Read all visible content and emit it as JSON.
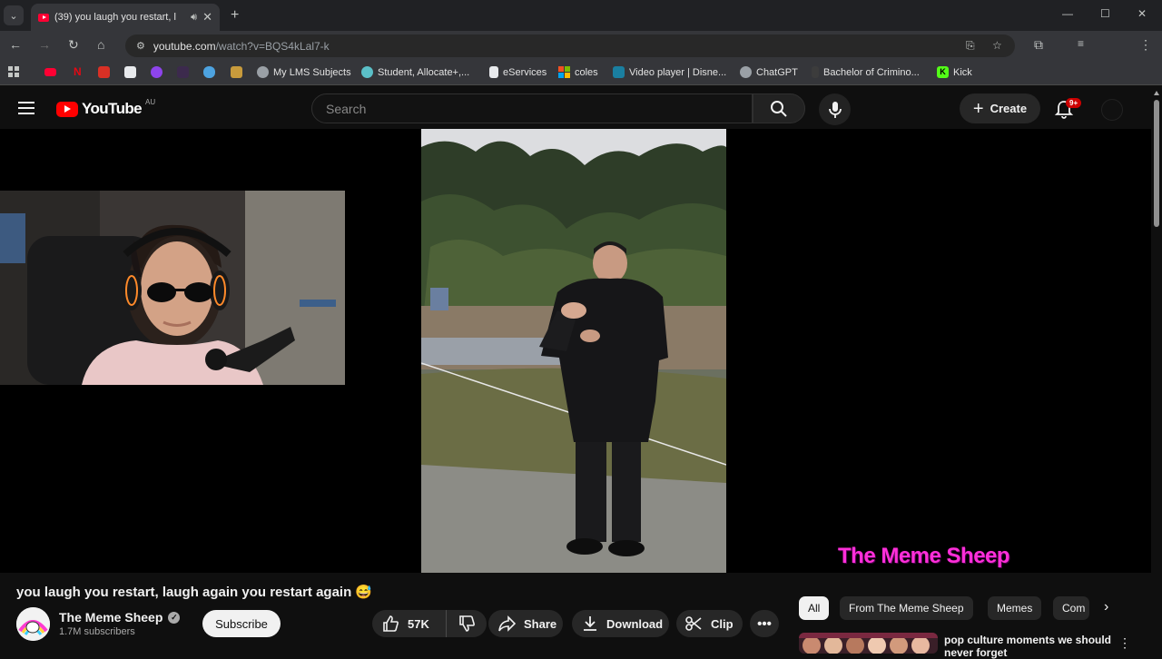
{
  "browser": {
    "tab_title": "(39) you laugh you restart, l",
    "url_host": "youtube.com",
    "url_path": "/watch?v=BQS4kLal7-k",
    "bookmarks": [
      {
        "label": "My LMS Subjects",
        "icon": "globe-icon"
      },
      {
        "label": "Student, Allocate+,...",
        "icon": "eye-icon"
      },
      {
        "label": "eServices",
        "icon": "page-icon"
      },
      {
        "label": "coles",
        "icon": "microsoft-icon"
      },
      {
        "label": "Video player | Disne...",
        "icon": "video-icon"
      },
      {
        "label": "ChatGPT",
        "icon": "chatgpt-icon"
      },
      {
        "label": "Bachelor of Crimino...",
        "icon": "page-icon"
      },
      {
        "label": "Kick",
        "icon": "kick-icon"
      }
    ]
  },
  "youtube": {
    "logo_text": "YouTube",
    "country_code": "AU",
    "search_placeholder": "Search",
    "create_label": "Create",
    "notification_badge": "9+"
  },
  "video": {
    "watermark": "The Meme Sheep",
    "title": "you laugh you restart, laugh again you restart again",
    "title_emoji": "😅",
    "channel_name": "The Meme Sheep",
    "subscribers": "1.7M subscribers",
    "subscribe_label": "Subscribe",
    "likes": "57K",
    "share_label": "Share",
    "download_label": "Download",
    "clip_label": "Clip"
  },
  "sidebar": {
    "chips": [
      {
        "label": "All",
        "active": true
      },
      {
        "label": "From The Meme Sheep",
        "active": false
      },
      {
        "label": "Memes",
        "active": false
      },
      {
        "label": "Com",
        "active": false
      }
    ],
    "suggestion_title": "pop culture moments we should never forget"
  }
}
